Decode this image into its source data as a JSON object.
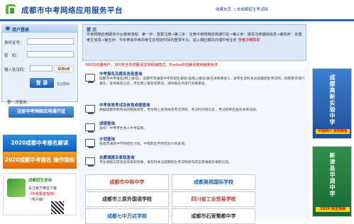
{
  "header": {
    "title": "成都市中考网络应用服务平台",
    "links": [
      "收藏本页",
      "去成都招生考试网"
    ]
  },
  "login": {
    "title": "用户登录",
    "id_label": "身份证号：",
    "password_label": "密　码：",
    "captcha_label": "输入验证码：",
    "captcha_text": "G8v6",
    "submit": "登 录",
    "forgot": "忘记密码"
  },
  "first_use": {
    "label": "第一次使用：",
    "register": "注册中考网络应用通行证"
  },
  "left_ads": {
    "banner1": "2020成都中考报名解读",
    "banner2": "2020成都中考报名 操作指南",
    "brand": "成都招生咨询",
    "line1": "关注官方微信下载",
    "line2": "《中考报名指南》",
    "line3": "（电子版）"
  },
  "notice": {
    "title": "提  示",
    "text": "中考网络应用服务平台使用流程：第一步：登录注册→第二步：注册中考网络应用通行证→第三步：填写注册基础信息→第四步：完善考生信息→第五步：今年参加中考的考生在规定时间内登录平台，进入相应模块办理中考业务",
    "link": "查看详细帮助"
  },
  "warning": "360浏览器用户，360安全浏览器请选择极速模式，Firefox浏览器请使用最新版本",
  "services": [
    {
      "title": "中考报名及报名信息查询",
      "desc": "成都市中考报名(网上报名)，成都市普通高中学校招生报名(含网上报名(报名资格审查))，请考生及时关注成都招生考试网，按照要求进行报名，查询报名信息，考生网上报名结束后，请到报名点进行资格审查。"
    },
    {
      "title": "中考体育考试及体育成绩查询",
      "desc": "根据成都市教育局的相关规定，考生网上查询体育考试项目、考试时间等信息，考试结束后查询体育成绩。"
    },
    {
      "title": "成绩查询",
      "desc": "查询：中考考生本人中考成绩。"
    },
    {
      "title": "计划查询",
      "desc": "各类普通高中学校招生计划，中等职业学校招生计划查询。"
    },
    {
      "title": "志愿填报及录取查询",
      "desc": "考生填报志愿及查询录取结果，请及时关注成都招生考试网发布的志愿填报及录取信息。"
    }
  ],
  "schools": [
    {
      "name": "成都市中和中学",
      "color": "#c0392b"
    },
    {
      "name": "成都美视国际学校",
      "color": "#1b5fa8"
    },
    {
      "name": "成都市三原外国语学校",
      "color": "#2f2f2f"
    },
    {
      "name": "四川省工业贸易学校",
      "color": "#c0392b"
    },
    {
      "name": "成都七中万达学校",
      "color": "#1b5fa8"
    },
    {
      "name": "成都市石室蜀都中学",
      "color": "#2f2f2f"
    }
  ],
  "right_ads": {
    "ad1": "成都高新实验中学",
    "ad1_sub": "中国四川 现场报名",
    "ad2": "新津县华润中学",
    "ad2_sub": "2020 招生热线"
  }
}
